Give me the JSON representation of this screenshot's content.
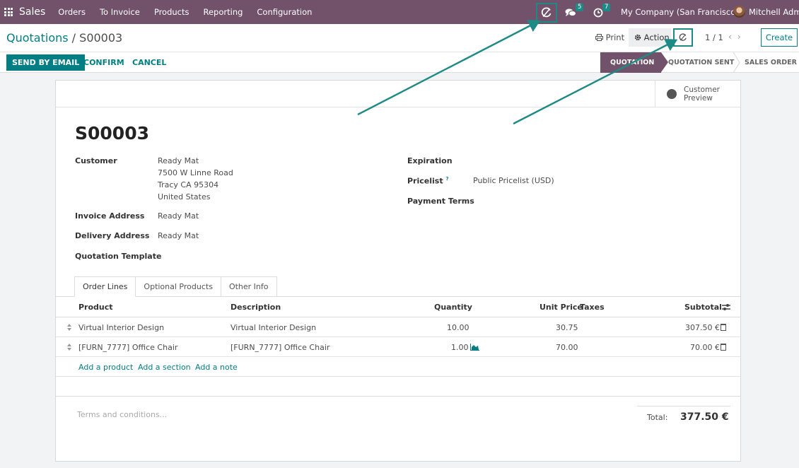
{
  "navbar": {
    "app_name": "Sales",
    "menu": [
      "Orders",
      "To Invoice",
      "Products",
      "Reporting",
      "Configuration"
    ],
    "messages_count": "5",
    "activities_count": "7",
    "company": "My Company (San Francisco)",
    "user": "Mitchell Admin"
  },
  "control": {
    "breadcrumb_parent": "Quotations",
    "breadcrumb_sep": " / ",
    "breadcrumb_current": "S00003",
    "print_label": "Print",
    "action_label": "Action",
    "pager": "1 / 1",
    "create_label": "Create"
  },
  "statusbar": {
    "send_by_email": "SEND BY EMAIL",
    "confirm": "CONFIRM",
    "cancel": "CANCEL",
    "stages": [
      "QUOTATION",
      "QUOTATION SENT",
      "SALES ORDER"
    ],
    "active_stage": "QUOTATION"
  },
  "form": {
    "customer_preview": "Customer Preview",
    "name": "S00003",
    "customer_label": "Customer",
    "customer_lines": [
      "Ready Mat",
      "7500 W Linne Road",
      "Tracy CA 95304",
      "United States"
    ],
    "invoice_address_label": "Invoice Address",
    "invoice_address": "Ready Mat",
    "delivery_address_label": "Delivery Address",
    "delivery_address": "Ready Mat",
    "quotation_template_label": "Quotation Template",
    "expiration_label": "Expiration",
    "pricelist_label": "Pricelist",
    "pricelist_tip": "?",
    "pricelist": "Public Pricelist (USD)",
    "payment_terms_label": "Payment Terms"
  },
  "tabs": [
    "Order Lines",
    "Optional Products",
    "Other Info"
  ],
  "order_lines": {
    "headers": {
      "product": "Product",
      "description": "Description",
      "quantity": "Quantity",
      "unit_price": "Unit Price",
      "taxes": "Taxes",
      "subtotal": "Subtotal"
    },
    "rows": [
      {
        "product": "Virtual Interior Design",
        "description": "Virtual Interior Design",
        "quantity": "10.00",
        "unit_price": "30.75",
        "subtotal": "307.50 €"
      },
      {
        "product": "[FURN_7777] Office Chair",
        "description": "[FURN_7777] Office Chair",
        "quantity": "1.00",
        "unit_price": "70.00",
        "subtotal": "70.00 €"
      }
    ],
    "add_product": "Add a product",
    "add_section": "Add a section",
    "add_note": "Add a note"
  },
  "footer": {
    "terms_placeholder": "Terms and conditions...",
    "total_label": "Total:",
    "total_value": "377.50 €"
  },
  "colors": {
    "navbar": "#71526a",
    "primary": "#017e84",
    "annotation": "#1d8a86"
  }
}
